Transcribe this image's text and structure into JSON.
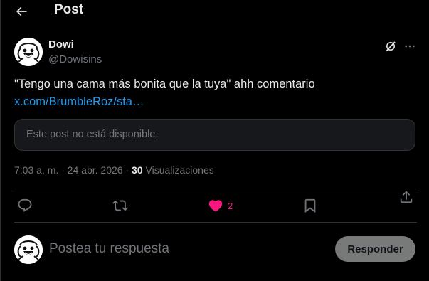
{
  "header": {
    "title": "Post",
    "back_icon": "arrow-left-icon"
  },
  "post": {
    "author_name": "Dowi",
    "author_handle": "@Dowisins",
    "text": "\"Tengo una cama más bonita que la tuya\" ahh comentario",
    "link": "x.com/BrumbleRoz/sta…",
    "unavailable_message": "Este post no está disponible.",
    "time": "7:03 a. m.",
    "separator": "·",
    "date": "24 abr. 2026",
    "views_count": "30",
    "views_label": "Visualizaciones"
  },
  "actions": {
    "reply_icon": "reply-icon",
    "repost_icon": "repost-icon",
    "like_icon": "heart-filled-icon",
    "like_count": "2",
    "bookmark_icon": "bookmark-icon",
    "share_icon": "share-icon"
  },
  "composer": {
    "placeholder": "Postea tu respuesta",
    "submit_label": "Responder"
  },
  "colors": {
    "background": "#000000",
    "text": "#e7e9ea",
    "muted": "#71767b",
    "link": "#1d9bf0",
    "like": "#f91880",
    "border": "#2f3336",
    "button_disabled": "#787a7a"
  }
}
